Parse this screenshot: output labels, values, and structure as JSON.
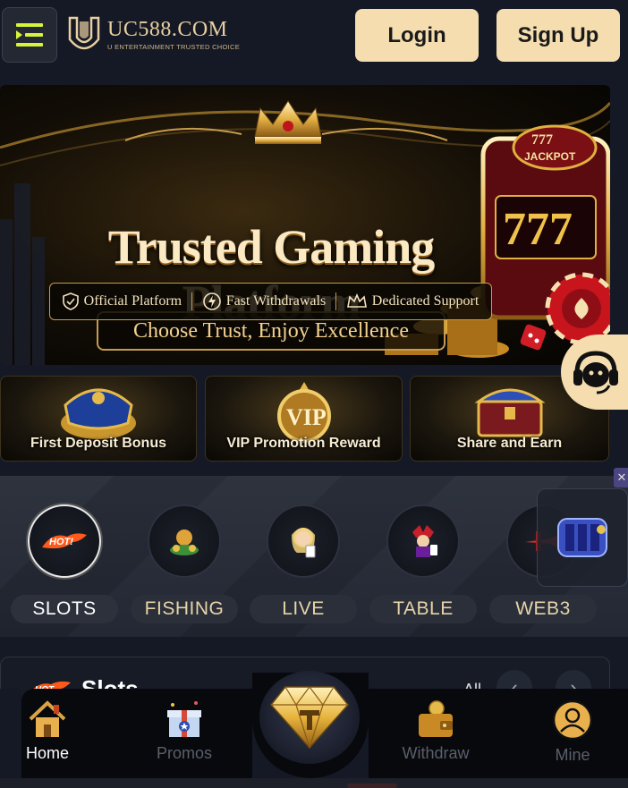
{
  "header": {
    "logo_title": "UC588.COM",
    "logo_subtitle": "U ENTERTAINMENT TRUSTED CHOICE",
    "login_label": "Login",
    "signup_label": "Sign Up"
  },
  "banner": {
    "title": "Trusted Gaming Platform",
    "subtitle": "Choose Trust, Enjoy Excellence",
    "features": [
      "Official Platform",
      "Fast Withdrawals",
      "Dedicated Support"
    ],
    "jackpot_label": "JACKPOT",
    "jackpot_number": "777"
  },
  "promos": [
    {
      "label": "First Deposit Bonus"
    },
    {
      "label": "VIP Promotion Reward"
    },
    {
      "label": "Share and Earn"
    }
  ],
  "categories": [
    {
      "label": "SLOTS",
      "icon": "hot-icon",
      "active": true
    },
    {
      "label": "FISHING",
      "icon": "fishing-icon"
    },
    {
      "label": "LIVE",
      "icon": "live-dealer-icon"
    },
    {
      "label": "TABLE",
      "icon": "table-joker-icon"
    },
    {
      "label": "WEB3",
      "icon": "plane-icon"
    }
  ],
  "slots_section": {
    "title": "Slots",
    "hot_badge": "HOT",
    "all_label": "All"
  },
  "bottom_nav": [
    {
      "label": "Home",
      "icon": "home-icon",
      "active": true
    },
    {
      "label": "Promos",
      "icon": "gift-icon"
    },
    {
      "label": "Withdraw",
      "icon": "wallet-icon"
    },
    {
      "label": "Mine",
      "icon": "user-icon"
    }
  ],
  "colors": {
    "background": "#151925",
    "accent_gold": "#f5ddb0",
    "pill_text": "#e7d4a8"
  }
}
